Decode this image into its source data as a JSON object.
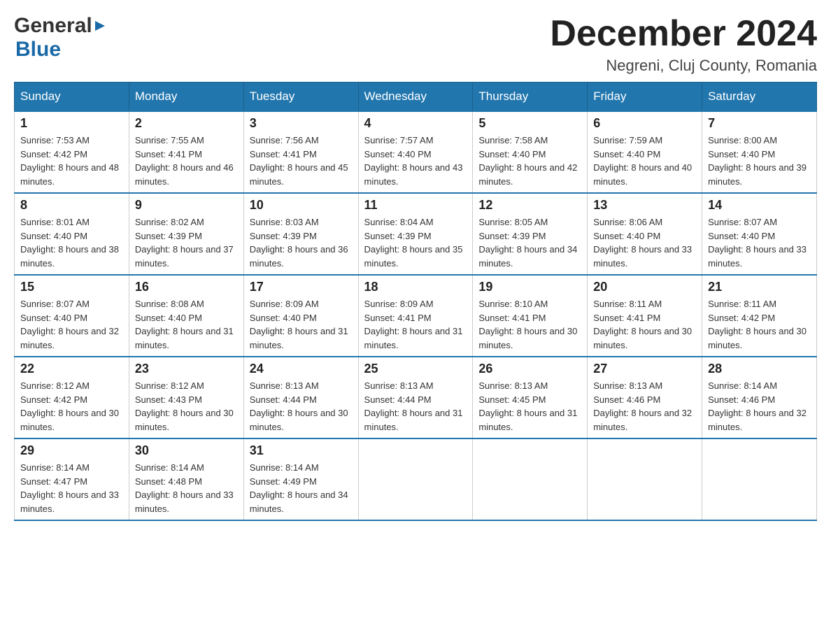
{
  "header": {
    "logo_general": "General",
    "logo_blue": "Blue",
    "month_title": "December 2024",
    "location": "Negreni, Cluj County, Romania"
  },
  "weekdays": [
    "Sunday",
    "Monday",
    "Tuesday",
    "Wednesday",
    "Thursday",
    "Friday",
    "Saturday"
  ],
  "weeks": [
    [
      {
        "day": "1",
        "sunrise": "7:53 AM",
        "sunset": "4:42 PM",
        "daylight": "8 hours and 48 minutes."
      },
      {
        "day": "2",
        "sunrise": "7:55 AM",
        "sunset": "4:41 PM",
        "daylight": "8 hours and 46 minutes."
      },
      {
        "day": "3",
        "sunrise": "7:56 AM",
        "sunset": "4:41 PM",
        "daylight": "8 hours and 45 minutes."
      },
      {
        "day": "4",
        "sunrise": "7:57 AM",
        "sunset": "4:40 PM",
        "daylight": "8 hours and 43 minutes."
      },
      {
        "day": "5",
        "sunrise": "7:58 AM",
        "sunset": "4:40 PM",
        "daylight": "8 hours and 42 minutes."
      },
      {
        "day": "6",
        "sunrise": "7:59 AM",
        "sunset": "4:40 PM",
        "daylight": "8 hours and 40 minutes."
      },
      {
        "day": "7",
        "sunrise": "8:00 AM",
        "sunset": "4:40 PM",
        "daylight": "8 hours and 39 minutes."
      }
    ],
    [
      {
        "day": "8",
        "sunrise": "8:01 AM",
        "sunset": "4:40 PM",
        "daylight": "8 hours and 38 minutes."
      },
      {
        "day": "9",
        "sunrise": "8:02 AM",
        "sunset": "4:39 PM",
        "daylight": "8 hours and 37 minutes."
      },
      {
        "day": "10",
        "sunrise": "8:03 AM",
        "sunset": "4:39 PM",
        "daylight": "8 hours and 36 minutes."
      },
      {
        "day": "11",
        "sunrise": "8:04 AM",
        "sunset": "4:39 PM",
        "daylight": "8 hours and 35 minutes."
      },
      {
        "day": "12",
        "sunrise": "8:05 AM",
        "sunset": "4:39 PM",
        "daylight": "8 hours and 34 minutes."
      },
      {
        "day": "13",
        "sunrise": "8:06 AM",
        "sunset": "4:40 PM",
        "daylight": "8 hours and 33 minutes."
      },
      {
        "day": "14",
        "sunrise": "8:07 AM",
        "sunset": "4:40 PM",
        "daylight": "8 hours and 33 minutes."
      }
    ],
    [
      {
        "day": "15",
        "sunrise": "8:07 AM",
        "sunset": "4:40 PM",
        "daylight": "8 hours and 32 minutes."
      },
      {
        "day": "16",
        "sunrise": "8:08 AM",
        "sunset": "4:40 PM",
        "daylight": "8 hours and 31 minutes."
      },
      {
        "day": "17",
        "sunrise": "8:09 AM",
        "sunset": "4:40 PM",
        "daylight": "8 hours and 31 minutes."
      },
      {
        "day": "18",
        "sunrise": "8:09 AM",
        "sunset": "4:41 PM",
        "daylight": "8 hours and 31 minutes."
      },
      {
        "day": "19",
        "sunrise": "8:10 AM",
        "sunset": "4:41 PM",
        "daylight": "8 hours and 30 minutes."
      },
      {
        "day": "20",
        "sunrise": "8:11 AM",
        "sunset": "4:41 PM",
        "daylight": "8 hours and 30 minutes."
      },
      {
        "day": "21",
        "sunrise": "8:11 AM",
        "sunset": "4:42 PM",
        "daylight": "8 hours and 30 minutes."
      }
    ],
    [
      {
        "day": "22",
        "sunrise": "8:12 AM",
        "sunset": "4:42 PM",
        "daylight": "8 hours and 30 minutes."
      },
      {
        "day": "23",
        "sunrise": "8:12 AM",
        "sunset": "4:43 PM",
        "daylight": "8 hours and 30 minutes."
      },
      {
        "day": "24",
        "sunrise": "8:13 AM",
        "sunset": "4:44 PM",
        "daylight": "8 hours and 30 minutes."
      },
      {
        "day": "25",
        "sunrise": "8:13 AM",
        "sunset": "4:44 PM",
        "daylight": "8 hours and 31 minutes."
      },
      {
        "day": "26",
        "sunrise": "8:13 AM",
        "sunset": "4:45 PM",
        "daylight": "8 hours and 31 minutes."
      },
      {
        "day": "27",
        "sunrise": "8:13 AM",
        "sunset": "4:46 PM",
        "daylight": "8 hours and 32 minutes."
      },
      {
        "day": "28",
        "sunrise": "8:14 AM",
        "sunset": "4:46 PM",
        "daylight": "8 hours and 32 minutes."
      }
    ],
    [
      {
        "day": "29",
        "sunrise": "8:14 AM",
        "sunset": "4:47 PM",
        "daylight": "8 hours and 33 minutes."
      },
      {
        "day": "30",
        "sunrise": "8:14 AM",
        "sunset": "4:48 PM",
        "daylight": "8 hours and 33 minutes."
      },
      {
        "day": "31",
        "sunrise": "8:14 AM",
        "sunset": "4:49 PM",
        "daylight": "8 hours and 34 minutes."
      },
      null,
      null,
      null,
      null
    ]
  ],
  "labels": {
    "sunrise_prefix": "Sunrise: ",
    "sunset_prefix": "Sunset: ",
    "daylight_prefix": "Daylight: "
  }
}
